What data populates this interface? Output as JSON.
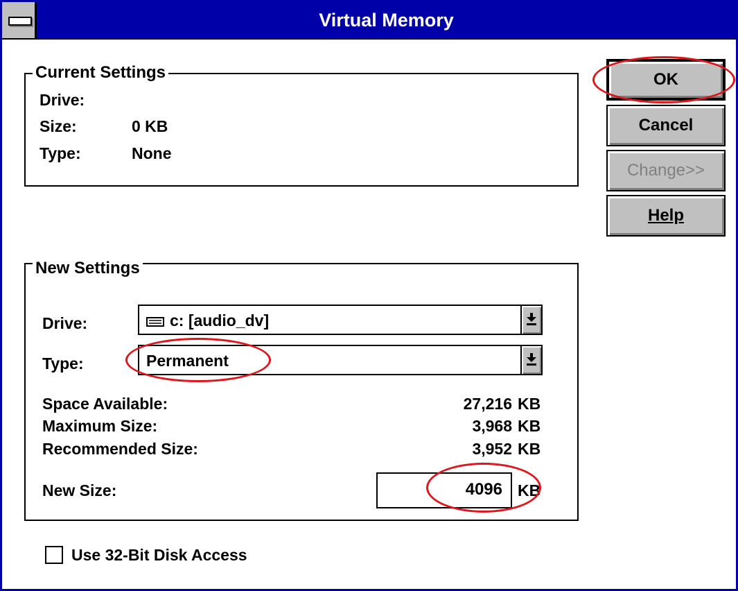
{
  "window": {
    "title": "Virtual Memory"
  },
  "current_settings": {
    "legend": "Current Settings",
    "drive_label": "Drive:",
    "drive_value": "",
    "size_label": "Size:",
    "size_value": "0 KB",
    "type_label": "Type:",
    "type_value": "None"
  },
  "buttons": {
    "ok": "OK",
    "cancel": "Cancel",
    "change": "Change>>",
    "help": "Help"
  },
  "new_settings": {
    "legend": "New Settings",
    "drive_label": "Drive:",
    "drive_value": "c: [audio_dv]",
    "type_label": "Type:",
    "type_value": "Permanent",
    "space_available_label": "Space Available:",
    "space_available_value": "27,216",
    "maximum_size_label": "Maximum Size:",
    "maximum_size_value": "3,968",
    "recommended_size_label": "Recommended Size:",
    "recommended_size_value": "3,952",
    "unit": "KB",
    "new_size_label": "New Size:",
    "new_size_value": "4096"
  },
  "checkbox": {
    "label": "Use 32-Bit Disk Access",
    "checked": false
  },
  "icons": {
    "drive": "hard-drive-icon",
    "dropdown": "dropdown-arrow-icon",
    "system_menu": "system-menu-icon"
  },
  "colors": {
    "title_bar": "#0000a8",
    "button_face": "#c0c0c0",
    "annotation": "#e0141b"
  }
}
